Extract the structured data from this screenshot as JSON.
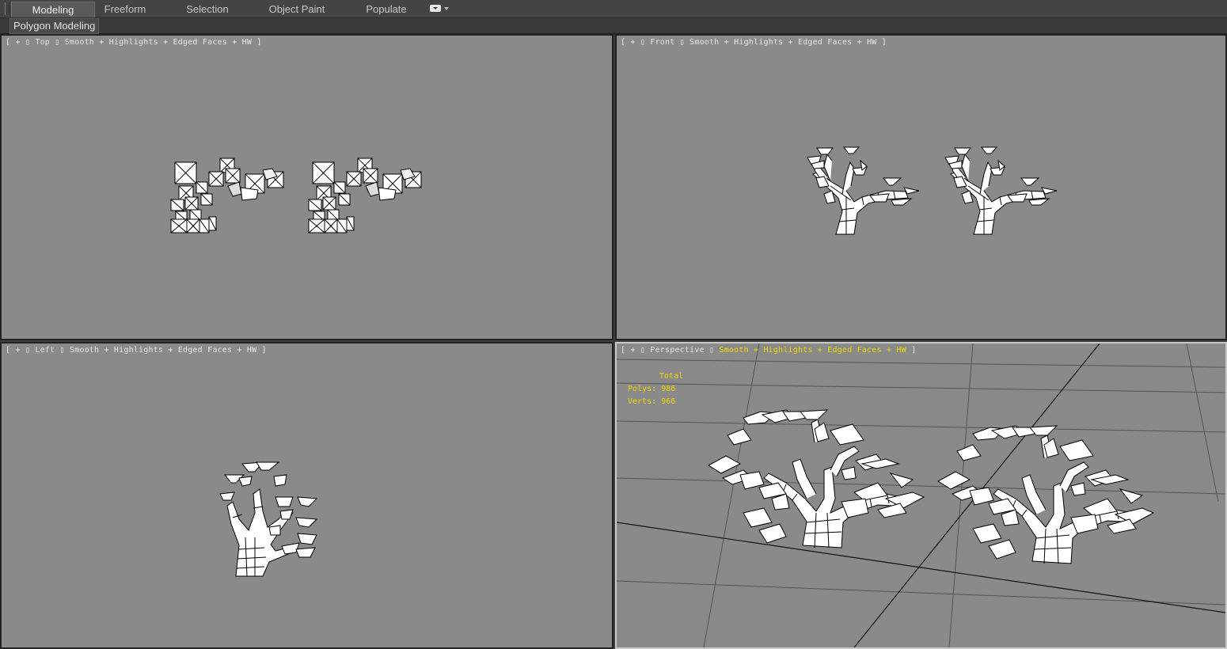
{
  "ribbon": {
    "tabs": [
      {
        "label": "Modeling",
        "active": true
      },
      {
        "label": "Freeform",
        "active": false
      },
      {
        "label": "Selection",
        "active": false
      },
      {
        "label": "Object Paint",
        "active": false
      },
      {
        "label": "Populate",
        "active": false
      }
    ],
    "panel_label": "Polygon Modeling"
  },
  "viewports": {
    "top": {
      "plus": "+",
      "name": "Top",
      "shading": "Smooth + Highlights + Edged Faces + HW"
    },
    "front": {
      "plus": "+",
      "name": "Front",
      "shading": "Smooth + Highlights + Edged Faces + HW"
    },
    "left": {
      "plus": "+",
      "name": "Left",
      "shading": "Smooth + Highlights + Edged Faces + HW"
    },
    "perspective": {
      "plus": "+",
      "name": "Perspective",
      "shading": "Smooth + Highlights + Edged Faces + HW",
      "stats": {
        "title": "Total",
        "polys_label": "Polys:",
        "polys": "986",
        "verts_label": "Verts:",
        "verts": "966"
      }
    }
  },
  "colors": {
    "viewport_bg": "#8a8a8a",
    "label_text": "#e8e8e8",
    "highlight_text": "#f0d800",
    "active_border": "#c9c9c9"
  }
}
